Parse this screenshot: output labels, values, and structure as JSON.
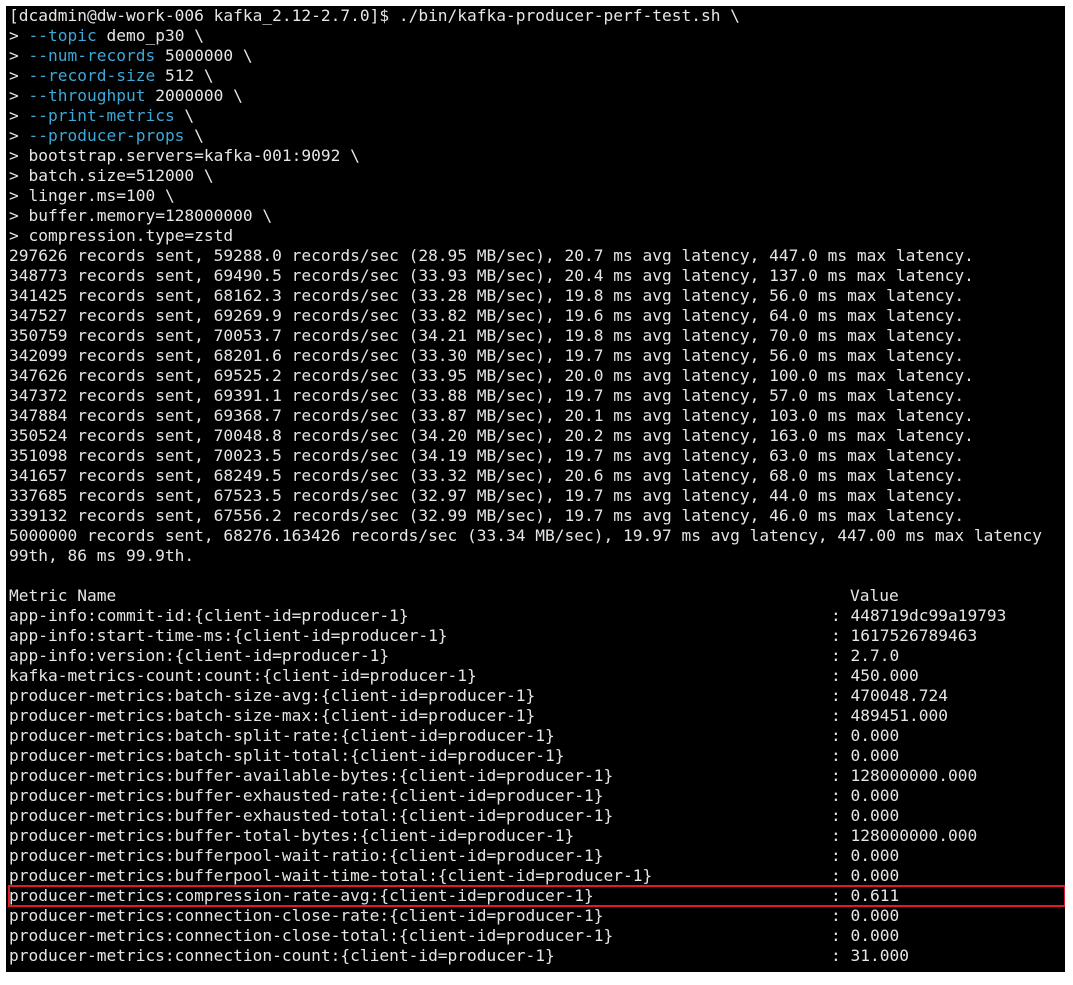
{
  "colors": {
    "background": "#000000",
    "text": "#e6e6e6",
    "option": "#3fa7d6",
    "highlight_box": "#e11b22"
  },
  "command": [
    {
      "prefix": "[dcadmin@dw-work-006 kafka_2.12-2.7.0]$ ",
      "opt": "",
      "rest": "./bin/kafka-producer-perf-test.sh \\"
    },
    {
      "prefix": "> ",
      "opt": "--topic",
      "rest": " demo_p30 \\"
    },
    {
      "prefix": "> ",
      "opt": "--num-records",
      "rest": " 5000000 \\"
    },
    {
      "prefix": "> ",
      "opt": "--record-size",
      "rest": " 512 \\"
    },
    {
      "prefix": "> ",
      "opt": "--throughput",
      "rest": " 2000000 \\"
    },
    {
      "prefix": "> ",
      "opt": "--print-metrics",
      "rest": " \\"
    },
    {
      "prefix": "> ",
      "opt": "--producer-props",
      "rest": " \\"
    },
    {
      "prefix": "> ",
      "opt": "",
      "rest": "bootstrap.servers=kafka-001:9092 \\"
    },
    {
      "prefix": "> ",
      "opt": "",
      "rest": "batch.size=512000 \\"
    },
    {
      "prefix": "> ",
      "opt": "",
      "rest": "linger.ms=100 \\"
    },
    {
      "prefix": "> ",
      "opt": "",
      "rest": "buffer.memory=128000000 \\"
    },
    {
      "prefix": "> ",
      "opt": "",
      "rest": "compression.type=zstd"
    }
  ],
  "progress": [
    "297626 records sent, 59288.0 records/sec (28.95 MB/sec), 20.7 ms avg latency, 447.0 ms max latency.",
    "348773 records sent, 69490.5 records/sec (33.93 MB/sec), 20.4 ms avg latency, 137.0 ms max latency.",
    "341425 records sent, 68162.3 records/sec (33.28 MB/sec), 19.8 ms avg latency, 56.0 ms max latency.",
    "347527 records sent, 69269.9 records/sec (33.82 MB/sec), 19.6 ms avg latency, 64.0 ms max latency.",
    "350759 records sent, 70053.7 records/sec (34.21 MB/sec), 19.8 ms avg latency, 70.0 ms max latency.",
    "342099 records sent, 68201.6 records/sec (33.30 MB/sec), 19.7 ms avg latency, 56.0 ms max latency.",
    "347626 records sent, 69525.2 records/sec (33.95 MB/sec), 20.0 ms avg latency, 100.0 ms max latency.",
    "347372 records sent, 69391.1 records/sec (33.88 MB/sec), 19.7 ms avg latency, 57.0 ms max latency.",
    "347884 records sent, 69368.7 records/sec (33.87 MB/sec), 20.1 ms avg latency, 103.0 ms max latency.",
    "350524 records sent, 70048.8 records/sec (34.20 MB/sec), 20.2 ms avg latency, 163.0 ms max latency.",
    "351098 records sent, 70023.5 records/sec (34.19 MB/sec), 19.7 ms avg latency, 63.0 ms max latency.",
    "341657 records sent, 68249.5 records/sec (33.32 MB/sec), 20.6 ms avg latency, 68.0 ms max latency.",
    "337685 records sent, 67523.5 records/sec (32.97 MB/sec), 19.7 ms avg latency, 44.0 ms max latency.",
    "339132 records sent, 67556.2 records/sec (32.99 MB/sec), 19.7 ms avg latency, 46.0 ms max latency."
  ],
  "summary": [
    "5000000 records sent, 68276.163426 records/sec (33.34 MB/sec), 19.97 ms avg latency, 447.00 ms max latency",
    "99th, 86 ms 99.9th."
  ],
  "metrics": {
    "header_name": "Metric Name",
    "header_value": "Value",
    "rows": [
      {
        "name": "app-info:commit-id:{client-id=producer-1}",
        "value": ": 448719dc99a19793"
      },
      {
        "name": "app-info:start-time-ms:{client-id=producer-1}",
        "value": ": 1617526789463"
      },
      {
        "name": "app-info:version:{client-id=producer-1}",
        "value": ": 2.7.0"
      },
      {
        "name": "kafka-metrics-count:count:{client-id=producer-1}",
        "value": ": 450.000"
      },
      {
        "name": "producer-metrics:batch-size-avg:{client-id=producer-1}",
        "value": ": 470048.724"
      },
      {
        "name": "producer-metrics:batch-size-max:{client-id=producer-1}",
        "value": ": 489451.000"
      },
      {
        "name": "producer-metrics:batch-split-rate:{client-id=producer-1}",
        "value": ": 0.000"
      },
      {
        "name": "producer-metrics:batch-split-total:{client-id=producer-1}",
        "value": ": 0.000"
      },
      {
        "name": "producer-metrics:buffer-available-bytes:{client-id=producer-1}",
        "value": ": 128000000.000"
      },
      {
        "name": "producer-metrics:buffer-exhausted-rate:{client-id=producer-1}",
        "value": ": 0.000"
      },
      {
        "name": "producer-metrics:buffer-exhausted-total:{client-id=producer-1}",
        "value": ": 0.000"
      },
      {
        "name": "producer-metrics:buffer-total-bytes:{client-id=producer-1}",
        "value": ": 128000000.000"
      },
      {
        "name": "producer-metrics:bufferpool-wait-ratio:{client-id=producer-1}",
        "value": ": 0.000"
      },
      {
        "name": "producer-metrics:bufferpool-wait-time-total:{client-id=producer-1}",
        "value": ": 0.000"
      },
      {
        "name": "producer-metrics:compression-rate-avg:{client-id=producer-1}",
        "value": ": 0.611",
        "highlighted": true
      },
      {
        "name": "producer-metrics:connection-close-rate:{client-id=producer-1}",
        "value": ": 0.000"
      },
      {
        "name": "producer-metrics:connection-close-total:{client-id=producer-1}",
        "value": ": 0.000"
      },
      {
        "name": "producer-metrics:connection-count:{client-id=producer-1}",
        "value": ": 31.000"
      }
    ]
  }
}
